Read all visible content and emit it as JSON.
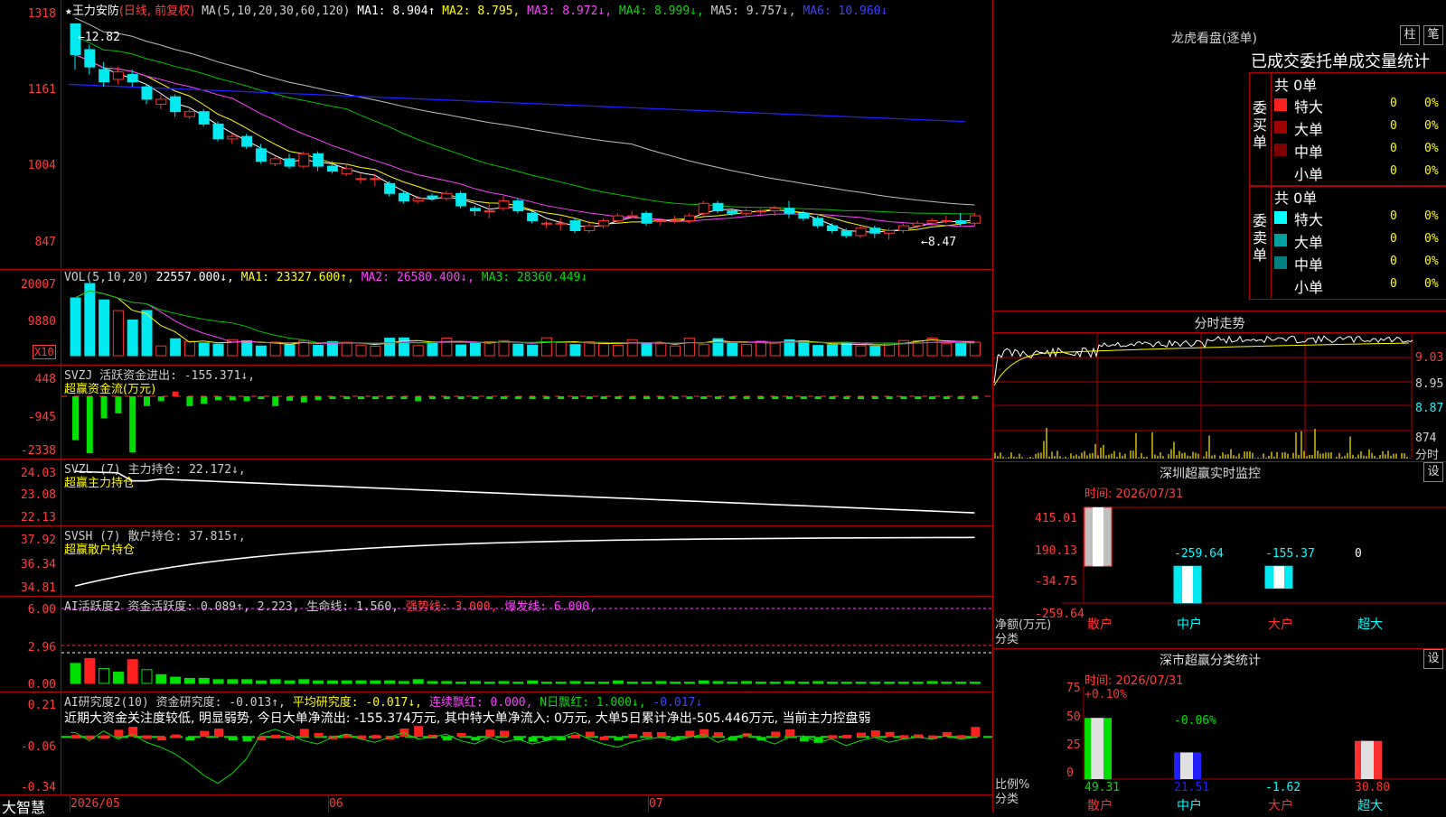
{
  "stock": {
    "star": "★",
    "name": "王力安防",
    "mode": "(日线, 前复权)",
    "ma_label": "MA(5,10,20,30,60,120)",
    "ma1": "MA1: 8.904↑",
    "ma2": "MA2: 8.795,",
    "ma3": "MA3: 8.972↓,",
    "ma4": "MA4: 8.999↓,",
    "ma5": "MA5: 9.757↓,",
    "ma6": "MA6: 10.960↓",
    "high_mark": "←12.82",
    "low_mark": "←8.47"
  },
  "price_axis": [
    "1318",
    "1161",
    "1004",
    "847"
  ],
  "vol": {
    "label": "VOL(5,10,20)",
    "v": "22557.000↓,",
    "ma1": "MA1: 23327.600↑,",
    "ma2": "MA2: 26580.400↓,",
    "ma3": "MA3: 28360.449↓",
    "axis": [
      "20007",
      "9880"
    ],
    "unit": "X10"
  },
  "svzj": {
    "label": "SVZJ  活跃资金进出: -155.371↓,",
    "sub": "超赢资金流(万元)",
    "axis": [
      "448",
      "-945",
      "-2338"
    ]
  },
  "svzl": {
    "label": "SVZL (7) 主力持仓: 22.172↓,",
    "sub": "超赢主力持仓",
    "axis": [
      "24.03",
      "23.08",
      "22.13"
    ]
  },
  "svsh": {
    "label": "SVSH (7) 散户持仓: 37.815↑,",
    "sub": "超赢散户持仓",
    "axis": [
      "37.92",
      "36.34",
      "34.81"
    ]
  },
  "ai1": {
    "label": "AI活跃度2 资金活跃度: 0.089↑, 2.223, 生命线: 1.560,",
    "strong": "强势线: 3.000,",
    "burst": "爆发线: 6.000,",
    "axis": [
      "6.00",
      "2.96",
      "0.00"
    ]
  },
  "ai2": {
    "label": "AI研究度2(10) 资金研究度: -0.013↑,",
    "avg": "平均研究度: -0.017↓,",
    "cont": "连续飘红: 0.000,",
    "nday": "N日飘红: 1.000↓,",
    "last": "-0.017↓",
    "comment": "近期大资金关注度较低, 明显弱势, 今日大单净流出: -155.374万元, 其中特大单净流入: 0万元, 大单5日累计净出-505.446万元, 当前主力控盘弱",
    "axis": [
      "0.21",
      "-0.06",
      "-0.34"
    ]
  },
  "footer": {
    "brand": "大智慧",
    "dates": [
      "2026/05",
      "06",
      "07"
    ]
  },
  "right": {
    "lhb_title": "龙虎看盘(逐单)",
    "btn1": "柱",
    "btn2": "笔",
    "table_title": "已成交委托单成交量统计",
    "buy_side": "委买单",
    "sell_side": "委卖单",
    "buy_total": "共 0单",
    "sell_total": "共 0单",
    "buy_rows": [
      {
        "name": "特大",
        "n": "0",
        "p": "0%"
      },
      {
        "name": "大单",
        "n": "0",
        "p": "0%"
      },
      {
        "name": "中单",
        "n": "0",
        "p": "0%"
      },
      {
        "name": "小单",
        "n": "0",
        "p": "0%"
      }
    ],
    "sell_rows": [
      {
        "name": "特大",
        "n": "0",
        "p": "0%"
      },
      {
        "name": "大单",
        "n": "0",
        "p": "0%"
      },
      {
        "name": "中单",
        "n": "0",
        "p": "0%"
      },
      {
        "name": "小单",
        "n": "0",
        "p": "0%"
      }
    ],
    "intraday_title": "分时走势",
    "intraday_axis": [
      "9.03",
      "8.95",
      "8.87",
      "874",
      "分时"
    ],
    "monitor_title": "深圳超赢实时监控",
    "monitor_btn": "设",
    "monitor_time": "时间: 2026/07/31",
    "monitor_axis": [
      "415.01",
      "190.13",
      "-34.75",
      "-259.64"
    ],
    "monitor_values": [
      "415.01",
      "-259.64",
      "-155.37",
      "0"
    ],
    "monitor_ylabel": "净额(万元)",
    "monitor_xlabel": "分类",
    "monitor_cats": [
      "散户",
      "中户",
      "大户",
      "超大"
    ],
    "stat_title": "深市超赢分类统计",
    "stat_btn": "设",
    "stat_time": "时间: 2026/07/31",
    "stat_axis": [
      "75",
      "50",
      "25",
      "0"
    ],
    "stat_top": [
      "+0.10%",
      "-0.06%"
    ],
    "stat_values": [
      "49.31",
      "21.51",
      "-1.62",
      "30.80"
    ],
    "stat_ylabel": "比例%",
    "stat_xlabel": "分类",
    "stat_cats": [
      "散户",
      "中户",
      "大户",
      "超大"
    ]
  },
  "chart_data": {
    "type": "candlestick",
    "series": [
      {
        "name": "MA1",
        "color": "#ffffff"
      },
      {
        "name": "MA2",
        "color": "#ffff00"
      },
      {
        "name": "MA3",
        "color": "#ff40ff"
      },
      {
        "name": "MA4",
        "color": "#00d000"
      },
      {
        "name": "MA5",
        "color": "#c0c0c0"
      },
      {
        "name": "MA6",
        "color": "#2020ff"
      }
    ],
    "candles": [
      [
        12.82,
        12.2,
        12.82,
        11.9
      ],
      [
        12.3,
        11.95,
        12.4,
        11.8
      ],
      [
        11.9,
        11.65,
        12.05,
        11.55
      ],
      [
        11.7,
        11.85,
        11.95,
        11.6
      ],
      [
        11.8,
        11.65,
        11.9,
        11.55
      ],
      [
        11.55,
        11.3,
        11.6,
        11.2
      ],
      [
        11.2,
        11.3,
        11.4,
        11.1
      ],
      [
        11.35,
        11.05,
        11.4,
        10.95
      ],
      [
        10.95,
        11.05,
        11.1,
        10.9
      ],
      [
        11.05,
        10.8,
        11.1,
        10.75
      ],
      [
        10.8,
        10.5,
        10.85,
        10.45
      ],
      [
        10.5,
        10.55,
        10.6,
        10.4
      ],
      [
        10.55,
        10.35,
        10.6,
        10.3
      ],
      [
        10.3,
        10.05,
        10.4,
        10.0
      ],
      [
        10.0,
        10.1,
        10.15,
        9.95
      ],
      [
        10.1,
        9.95,
        10.2,
        9.9
      ],
      [
        9.95,
        10.2,
        10.25,
        9.9
      ],
      [
        10.2,
        9.95,
        10.25,
        9.85
      ],
      [
        9.95,
        9.85,
        10.05,
        9.8
      ],
      [
        9.8,
        9.9,
        10.0,
        9.75
      ],
      [
        9.7,
        9.7,
        9.8,
        9.6
      ],
      [
        9.7,
        9.7,
        9.8,
        9.55
      ],
      [
        9.6,
        9.4,
        9.65,
        9.35
      ],
      [
        9.4,
        9.25,
        9.45,
        9.2
      ],
      [
        9.25,
        9.3,
        9.35,
        9.2
      ],
      [
        9.35,
        9.3,
        9.4,
        9.25
      ],
      [
        9.3,
        9.4,
        9.45,
        9.25
      ],
      [
        9.4,
        9.15,
        9.45,
        9.1
      ],
      [
        9.1,
        9.05,
        9.15,
        8.95
      ],
      [
        9.05,
        9.05,
        9.2,
        8.9
      ],
      [
        9.1,
        9.25,
        9.35,
        9.05
      ],
      [
        9.25,
        9.05,
        9.3,
        9.0
      ],
      [
        9.0,
        8.85,
        9.05,
        8.8
      ],
      [
        8.8,
        8.8,
        8.85,
        8.7
      ],
      [
        8.8,
        8.8,
        8.9,
        8.65
      ],
      [
        8.85,
        8.65,
        8.9,
        8.6
      ],
      [
        8.65,
        8.75,
        8.85,
        8.6
      ],
      [
        8.75,
        8.85,
        8.9,
        8.7
      ],
      [
        8.85,
        8.95,
        9.0,
        8.8
      ],
      [
        8.95,
        8.95,
        9.05,
        8.9
      ],
      [
        9.0,
        8.8,
        9.05,
        8.75
      ],
      [
        8.85,
        8.85,
        8.9,
        8.75
      ],
      [
        8.85,
        8.85,
        8.95,
        8.8
      ],
      [
        8.85,
        8.95,
        9.0,
        8.8
      ],
      [
        9.0,
        9.2,
        9.25,
        8.95
      ],
      [
        9.2,
        9.05,
        9.25,
        9.0
      ],
      [
        9.05,
        9.0,
        9.1,
        8.95
      ],
      [
        9.0,
        9.05,
        9.1,
        8.95
      ],
      [
        9.05,
        9.05,
        9.1,
        8.95
      ],
      [
        9.05,
        9.1,
        9.15,
        8.95
      ],
      [
        9.1,
        9.0,
        9.25,
        8.9
      ],
      [
        9.0,
        8.9,
        9.05,
        8.85
      ],
      [
        8.9,
        8.75,
        8.95,
        8.7
      ],
      [
        8.75,
        8.65,
        8.8,
        8.6
      ],
      [
        8.65,
        8.55,
        8.7,
        8.5
      ],
      [
        8.55,
        8.7,
        8.75,
        8.5
      ],
      [
        8.7,
        8.6,
        8.75,
        8.5
      ],
      [
        8.6,
        8.65,
        8.7,
        8.47
      ],
      [
        8.65,
        8.75,
        8.8,
        8.6
      ],
      [
        8.75,
        8.8,
        8.85,
        8.7
      ],
      [
        8.8,
        8.85,
        8.9,
        8.75
      ],
      [
        8.85,
        8.85,
        8.95,
        8.8
      ],
      [
        8.85,
        8.8,
        9.0,
        8.75
      ],
      [
        8.8,
        8.95,
        9.0,
        8.75
      ]
    ]
  }
}
